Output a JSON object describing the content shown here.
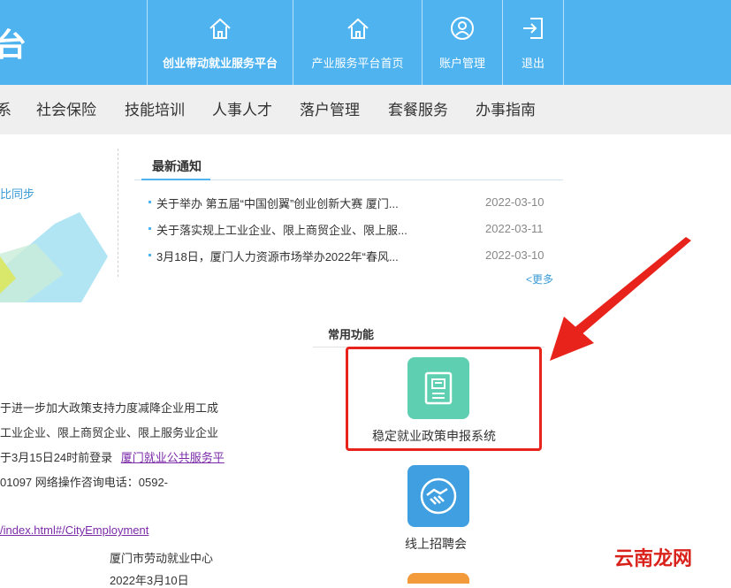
{
  "header": {
    "brand_partial": "台",
    "nav": [
      {
        "label": "创业带动就业服务平台",
        "icon": "home-icon"
      },
      {
        "label": "产业服务平台首页",
        "icon": "home-icon"
      },
      {
        "label": "账户管理",
        "icon": "user-icon"
      },
      {
        "label": "退出",
        "icon": "logout-icon"
      }
    ]
  },
  "mainnav": {
    "items": [
      "系",
      "社会保险",
      "技能培训",
      "人事人才",
      "落户管理",
      "套餐服务",
      "办事指南"
    ]
  },
  "banner": {
    "sync_text": "比同步"
  },
  "notices": {
    "title": "最新通知",
    "items": [
      {
        "text": "关于举办 第五届“中国创翼”创业创新大赛 厦门...",
        "date": "2022-03-10"
      },
      {
        "text": "关于落实规上工业企业、限上商贸企业、限上服...",
        "date": "2022-03-11"
      },
      {
        "text": "3月18日，厦门人力资源市场举办2022年“春风...",
        "date": "2022-03-10"
      }
    ],
    "more": "<更多"
  },
  "functions": {
    "title": "常用功能",
    "items": [
      {
        "label": "稳定就业政策申报系统",
        "icon": "document-icon",
        "color": "#5ecfb0"
      },
      {
        "label": "线上招聘会",
        "icon": "handshake-icon",
        "color": "#3f9fe0"
      }
    ]
  },
  "article": {
    "lines": [
      "于进一步加大政策支持力度减降企业用工成",
      "工业企业、限上商贸企业、限上服务业企业",
      "于3月15日24时前登录",
      "01097    网络操作咨询电话：0592-",
      "厦门市劳动就业中心",
      "2022年3月10日"
    ],
    "link1": "厦门就业公共服务平",
    "link2": "/index.html#/CityEmployment"
  },
  "watermark": "云南龙网",
  "colors": {
    "header": "#4fb3ef",
    "highlight": "#e8231c",
    "tile1": "#5ecfb0",
    "tile2": "#3f9fe0"
  }
}
